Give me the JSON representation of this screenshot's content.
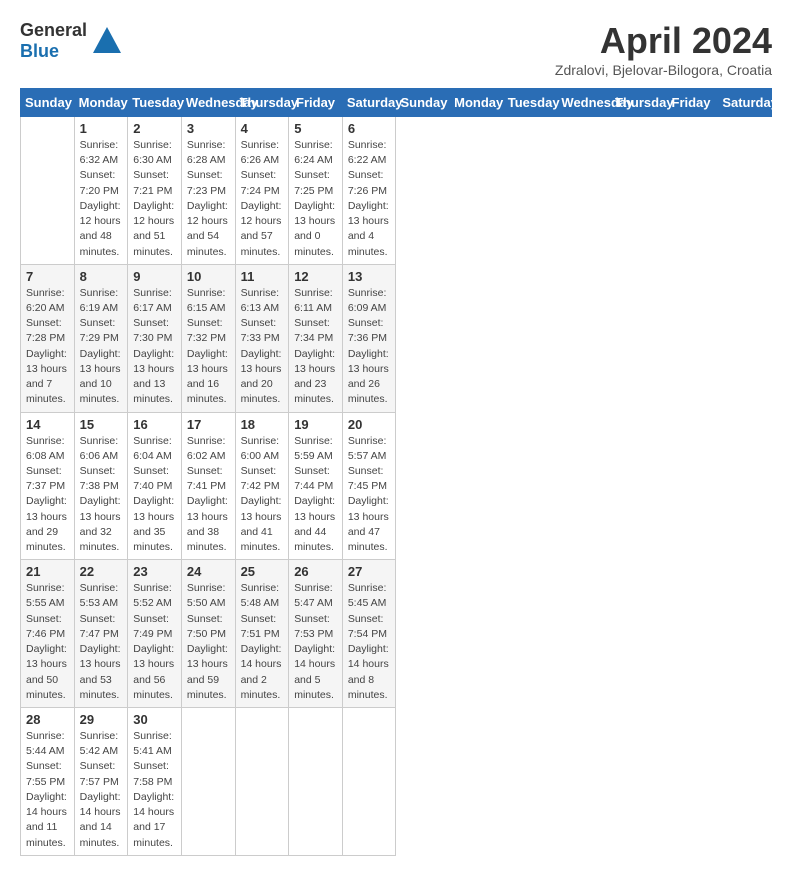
{
  "header": {
    "logo_general": "General",
    "logo_blue": "Blue",
    "month_title": "April 2024",
    "location": "Zdralovi, Bjelovar-Bilogora, Croatia"
  },
  "days_of_week": [
    "Sunday",
    "Monday",
    "Tuesday",
    "Wednesday",
    "Thursday",
    "Friday",
    "Saturday"
  ],
  "weeks": [
    [
      {
        "day": "",
        "info": ""
      },
      {
        "day": "1",
        "info": "Sunrise: 6:32 AM\nSunset: 7:20 PM\nDaylight: 12 hours\nand 48 minutes."
      },
      {
        "day": "2",
        "info": "Sunrise: 6:30 AM\nSunset: 7:21 PM\nDaylight: 12 hours\nand 51 minutes."
      },
      {
        "day": "3",
        "info": "Sunrise: 6:28 AM\nSunset: 7:23 PM\nDaylight: 12 hours\nand 54 minutes."
      },
      {
        "day": "4",
        "info": "Sunrise: 6:26 AM\nSunset: 7:24 PM\nDaylight: 12 hours\nand 57 minutes."
      },
      {
        "day": "5",
        "info": "Sunrise: 6:24 AM\nSunset: 7:25 PM\nDaylight: 13 hours\nand 0 minutes."
      },
      {
        "day": "6",
        "info": "Sunrise: 6:22 AM\nSunset: 7:26 PM\nDaylight: 13 hours\nand 4 minutes."
      }
    ],
    [
      {
        "day": "7",
        "info": "Sunrise: 6:20 AM\nSunset: 7:28 PM\nDaylight: 13 hours\nand 7 minutes."
      },
      {
        "day": "8",
        "info": "Sunrise: 6:19 AM\nSunset: 7:29 PM\nDaylight: 13 hours\nand 10 minutes."
      },
      {
        "day": "9",
        "info": "Sunrise: 6:17 AM\nSunset: 7:30 PM\nDaylight: 13 hours\nand 13 minutes."
      },
      {
        "day": "10",
        "info": "Sunrise: 6:15 AM\nSunset: 7:32 PM\nDaylight: 13 hours\nand 16 minutes."
      },
      {
        "day": "11",
        "info": "Sunrise: 6:13 AM\nSunset: 7:33 PM\nDaylight: 13 hours\nand 20 minutes."
      },
      {
        "day": "12",
        "info": "Sunrise: 6:11 AM\nSunset: 7:34 PM\nDaylight: 13 hours\nand 23 minutes."
      },
      {
        "day": "13",
        "info": "Sunrise: 6:09 AM\nSunset: 7:36 PM\nDaylight: 13 hours\nand 26 minutes."
      }
    ],
    [
      {
        "day": "14",
        "info": "Sunrise: 6:08 AM\nSunset: 7:37 PM\nDaylight: 13 hours\nand 29 minutes."
      },
      {
        "day": "15",
        "info": "Sunrise: 6:06 AM\nSunset: 7:38 PM\nDaylight: 13 hours\nand 32 minutes."
      },
      {
        "day": "16",
        "info": "Sunrise: 6:04 AM\nSunset: 7:40 PM\nDaylight: 13 hours\nand 35 minutes."
      },
      {
        "day": "17",
        "info": "Sunrise: 6:02 AM\nSunset: 7:41 PM\nDaylight: 13 hours\nand 38 minutes."
      },
      {
        "day": "18",
        "info": "Sunrise: 6:00 AM\nSunset: 7:42 PM\nDaylight: 13 hours\nand 41 minutes."
      },
      {
        "day": "19",
        "info": "Sunrise: 5:59 AM\nSunset: 7:44 PM\nDaylight: 13 hours\nand 44 minutes."
      },
      {
        "day": "20",
        "info": "Sunrise: 5:57 AM\nSunset: 7:45 PM\nDaylight: 13 hours\nand 47 minutes."
      }
    ],
    [
      {
        "day": "21",
        "info": "Sunrise: 5:55 AM\nSunset: 7:46 PM\nDaylight: 13 hours\nand 50 minutes."
      },
      {
        "day": "22",
        "info": "Sunrise: 5:53 AM\nSunset: 7:47 PM\nDaylight: 13 hours\nand 53 minutes."
      },
      {
        "day": "23",
        "info": "Sunrise: 5:52 AM\nSunset: 7:49 PM\nDaylight: 13 hours\nand 56 minutes."
      },
      {
        "day": "24",
        "info": "Sunrise: 5:50 AM\nSunset: 7:50 PM\nDaylight: 13 hours\nand 59 minutes."
      },
      {
        "day": "25",
        "info": "Sunrise: 5:48 AM\nSunset: 7:51 PM\nDaylight: 14 hours\nand 2 minutes."
      },
      {
        "day": "26",
        "info": "Sunrise: 5:47 AM\nSunset: 7:53 PM\nDaylight: 14 hours\nand 5 minutes."
      },
      {
        "day": "27",
        "info": "Sunrise: 5:45 AM\nSunset: 7:54 PM\nDaylight: 14 hours\nand 8 minutes."
      }
    ],
    [
      {
        "day": "28",
        "info": "Sunrise: 5:44 AM\nSunset: 7:55 PM\nDaylight: 14 hours\nand 11 minutes."
      },
      {
        "day": "29",
        "info": "Sunrise: 5:42 AM\nSunset: 7:57 PM\nDaylight: 14 hours\nand 14 minutes."
      },
      {
        "day": "30",
        "info": "Sunrise: 5:41 AM\nSunset: 7:58 PM\nDaylight: 14 hours\nand 17 minutes."
      },
      {
        "day": "",
        "info": ""
      },
      {
        "day": "",
        "info": ""
      },
      {
        "day": "",
        "info": ""
      },
      {
        "day": "",
        "info": ""
      }
    ]
  ]
}
